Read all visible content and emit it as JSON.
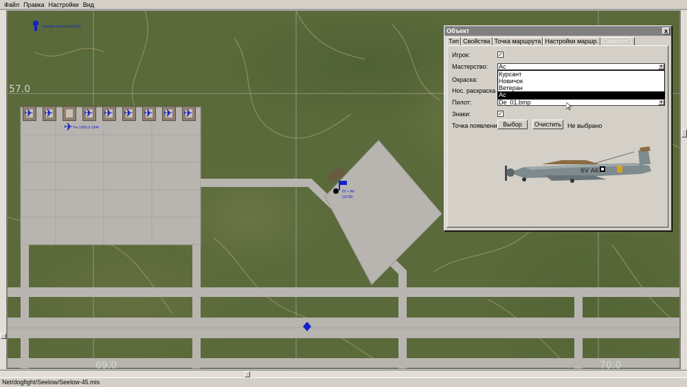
{
  "menu": [
    "Файл",
    "Правка",
    "Настройки",
    "Вид"
  ],
  "map": {
    "grid_labels": [
      "57.0",
      "69.0",
      "70.0"
    ],
    "static_object_label": "Стрелки стоянки Бк1000",
    "aircraft_label": "Fw 190D-9 1944",
    "selected_flight_label": "6V + AK",
    "selected_flight_altitude": "(10.00)"
  },
  "dialog": {
    "title": "Объект",
    "close": "x",
    "tabs": [
      "Тип",
      "Свойства",
      "Точка маршрута",
      "Настройки маршр.",
      "Самолет 1"
    ],
    "active_tab": 4,
    "fields": {
      "player_label": "Игрок:",
      "player_checked": true,
      "skill_label": "Мастерство:",
      "skill_value": "Ас",
      "skin_label": "Окраска:",
      "nose_label": "Нос. раскраска",
      "pilot_label": "Пилот:",
      "pilot_value": "De_01.bmp",
      "markings_label": "Знаки:",
      "markings_checked": true,
      "spawn_label": "Точка появлени",
      "select_button": "Выбор",
      "clear_button": "Очистить",
      "spawn_value": "Не выбрано"
    },
    "skill_options": [
      "Курсант",
      "Новичок",
      "Ветеран",
      "Ас"
    ],
    "skill_selected_index": 3,
    "aircraft_marking": "6V AK"
  },
  "status": "Net/dogfight/Seelow/Seelow-45.mis",
  "colors": {
    "map_green": "#5a6a3a",
    "runway": "#b8b5b0",
    "blue_unit": "#1420c8",
    "titlebar": "#808080"
  }
}
